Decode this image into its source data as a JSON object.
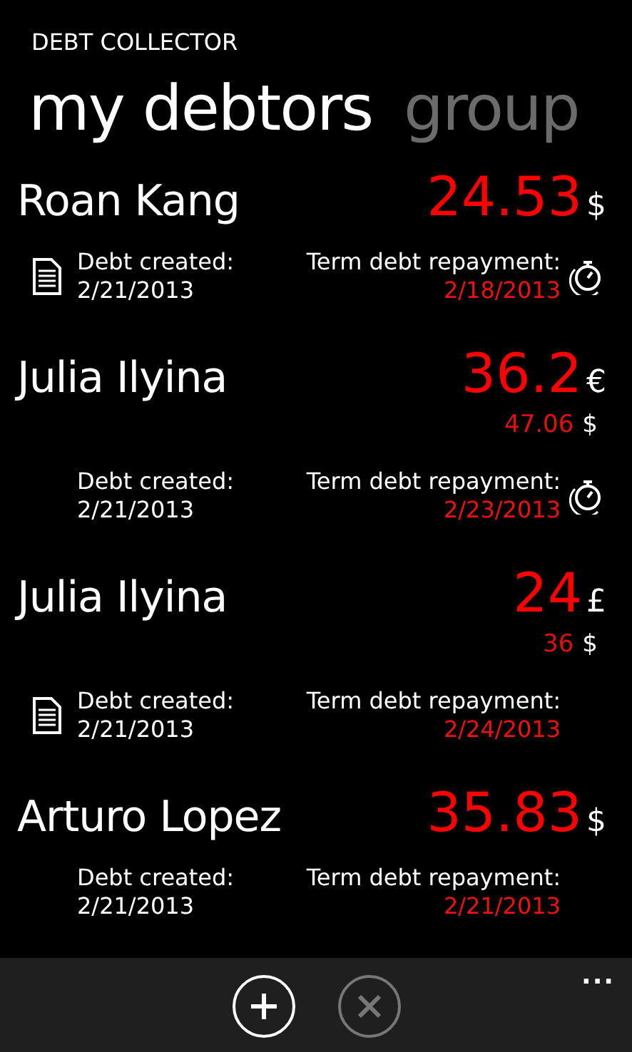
{
  "app_title": "DEBT COLLECTOR",
  "pivot": [
    {
      "label": "my debtors",
      "selected": true
    },
    {
      "label": "group",
      "selected": false
    }
  ],
  "debtors": [
    {
      "name": "Roan Kang",
      "amount": "24.53",
      "currency": "$",
      "has_note": true,
      "created_label": "Debt created:",
      "created_date": "2/21/2013",
      "term_label": "Term debt repayment:",
      "term_date": "2/18/2013",
      "has_timer": true
    },
    {
      "name": "Julia Ilyina",
      "amount": "36.2",
      "currency": "€",
      "converted": {
        "amount": "47.06",
        "currency": "$"
      },
      "has_note": false,
      "created_label": "Debt created:",
      "created_date": "2/21/2013",
      "term_label": "Term debt repayment:",
      "term_date": "2/23/2013",
      "has_timer": true
    },
    {
      "name": "Julia Ilyina",
      "amount": "24",
      "currency": "£",
      "converted": {
        "amount": "36",
        "currency": "$"
      },
      "has_note": true,
      "created_label": "Debt created:",
      "created_date": "2/21/2013",
      "term_label": "Term debt repayment:",
      "term_date": "2/24/2013",
      "has_timer": false
    },
    {
      "name": "Arturo Lopez",
      "amount": "35.83",
      "currency": "$",
      "has_note": false,
      "created_label": "Debt created:",
      "created_date": "2/21/2013",
      "term_label": "Term debt repayment:",
      "term_date": "2/21/2013",
      "has_timer": false
    }
  ],
  "app_bar": {
    "buttons": [
      {
        "kind": "add",
        "disabled": false
      },
      {
        "kind": "cancel",
        "disabled": true
      }
    ],
    "more": "..."
  }
}
